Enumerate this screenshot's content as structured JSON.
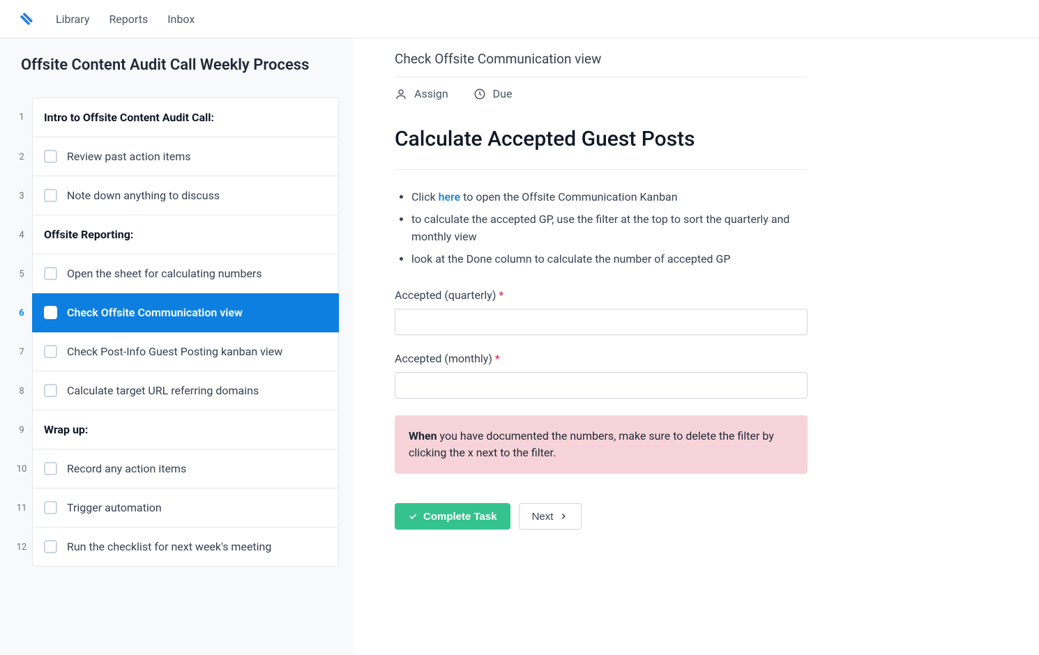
{
  "nav": {
    "library": "Library",
    "reports": "Reports",
    "inbox": "Inbox"
  },
  "process": {
    "title": "Offsite Content Audit Call Weekly Process",
    "steps": [
      {
        "num": "1",
        "type": "heading",
        "label": "Intro to Offsite Content Audit Call:"
      },
      {
        "num": "2",
        "type": "task",
        "label": "Review past action items"
      },
      {
        "num": "3",
        "type": "task",
        "label": "Note down anything to discuss"
      },
      {
        "num": "4",
        "type": "heading",
        "label": "Offsite Reporting:"
      },
      {
        "num": "5",
        "type": "task",
        "label": "Open the sheet for calculating numbers"
      },
      {
        "num": "6",
        "type": "task",
        "label": "Check Offsite Communication view",
        "active": true
      },
      {
        "num": "7",
        "type": "task",
        "label": "Check Post-Info Guest Posting kanban view"
      },
      {
        "num": "8",
        "type": "task",
        "label": "Calculate target URL referring domains"
      },
      {
        "num": "9",
        "type": "heading",
        "label": "Wrap up:"
      },
      {
        "num": "10",
        "type": "task",
        "label": "Record any action items"
      },
      {
        "num": "11",
        "type": "task",
        "label": "Trigger automation"
      },
      {
        "num": "12",
        "type": "task",
        "label": "Run the checklist for next week's meeting"
      }
    ]
  },
  "detail": {
    "crumb": "Check Offsite Communication view",
    "assign": "Assign",
    "due": "Due",
    "title": "Calculate Accepted Guest Posts",
    "instr_prefix": "Click ",
    "instr_link": "here",
    "instr_suffix": " to open the Offsite Communication Kanban",
    "instr2": "to calculate the accepted GP, use the filter at the top to sort the quarterly and monthly view",
    "instr3": "look at the Done column to calculate the number of accepted GP",
    "field1_label": "Accepted (quarterly) ",
    "field2_label": "Accepted (monthly) ",
    "req": "*",
    "callout_b": "When ",
    "callout_rest": "you have documented the numbers, make sure to delete the filter by clicking the x next to the filter.",
    "complete": "Complete Task",
    "next": "Next"
  }
}
